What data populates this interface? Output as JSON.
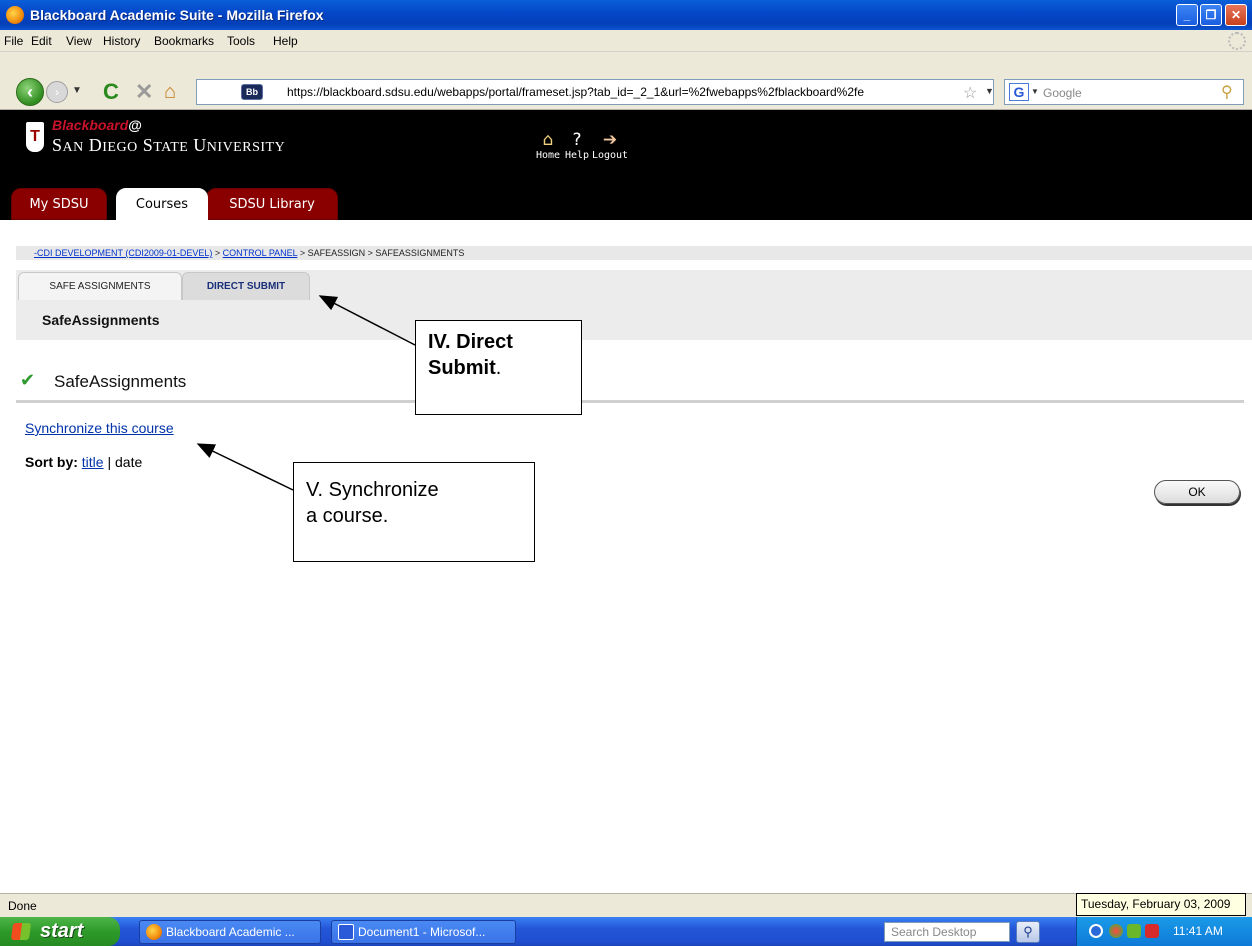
{
  "window": {
    "title": "Blackboard Academic Suite - Mozilla Firefox"
  },
  "menu": [
    "File",
    "Edit",
    "View",
    "History",
    "Bookmarks",
    "Tools",
    "Help"
  ],
  "nav": {
    "url": "https://blackboard.sdsu.edu/webapps/portal/frameset.jsp?tab_id=_2_1&url=%2fwebapps%2fblackboard%2fe",
    "search_placeholder": "Google",
    "site_badge": "Bb"
  },
  "header": {
    "brand": "Blackboard",
    "at": "@",
    "university": "San Diego State University",
    "top_links": [
      {
        "label": "Home",
        "icon": "home-icon"
      },
      {
        "label": "Help",
        "icon": "help-icon"
      },
      {
        "label": "Logout",
        "icon": "logout-icon"
      }
    ],
    "tabs": [
      {
        "label": "My SDSU",
        "active": false
      },
      {
        "label": "Courses",
        "active": true
      },
      {
        "label": "SDSU Library",
        "active": false
      }
    ]
  },
  "breadcrumb": {
    "course": "-CDI DEVELOPMENT (CDI2009-01-DEVEL)",
    "sep1": " > ",
    "control_panel": "CONTROL PANEL",
    "sep2": " > ",
    "safeassign": "SAFEASSIGN",
    "sep3": " > ",
    "current": "SAFEASSIGNMENTS"
  },
  "subtabs": [
    {
      "label": "SAFE ASSIGNMENTS",
      "active": true
    },
    {
      "label": "DIRECT SUBMIT",
      "active": false
    }
  ],
  "sub_heading": "SafeAssignments",
  "section": {
    "title": "SafeAssignments",
    "sync_link": "Synchronize this course",
    "sort_label": "Sort by:",
    "sort_title": "title",
    "sort_sep": " | ",
    "sort_date": "date",
    "ok_button": "OK"
  },
  "callouts": {
    "direct_line1": "IV. Direct",
    "direct_line2_bold": "Submit",
    "direct_line2_plain": ".",
    "sync_line1": "V. Synchronize",
    "sync_line2": "a course."
  },
  "status": {
    "text": "Done",
    "date_tooltip": "Tuesday, February 03, 2009"
  },
  "taskbar": {
    "start": "start",
    "tasks": [
      "Blackboard Academic ...",
      "Document1 - Microsof..."
    ],
    "search_placeholder": "Search Desktop",
    "clock": "11:41 AM"
  }
}
